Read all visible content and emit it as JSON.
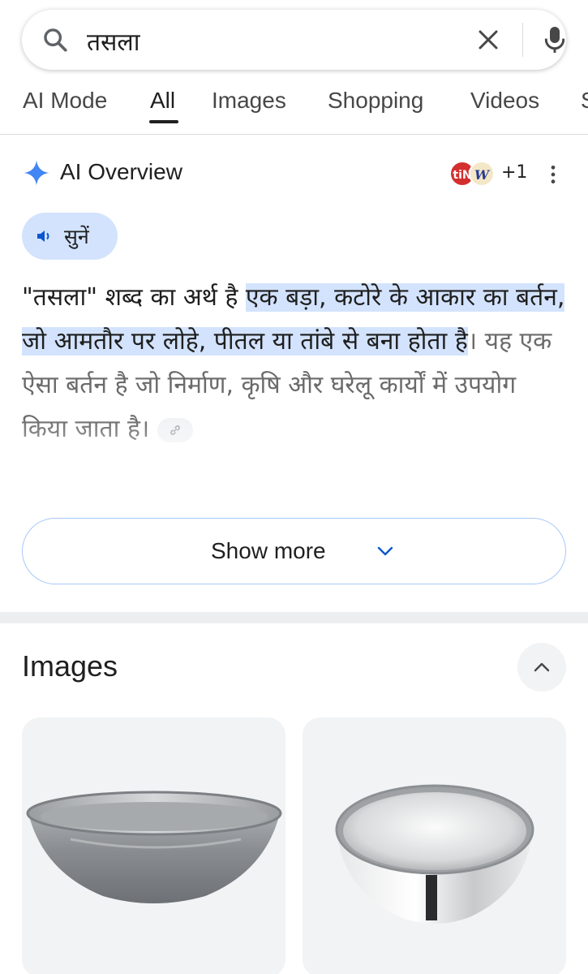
{
  "search": {
    "query": "तसला"
  },
  "tabs": [
    {
      "label": "AI Mode"
    },
    {
      "label": "All"
    },
    {
      "label": "Images"
    },
    {
      "label": "Shopping"
    },
    {
      "label": "Videos"
    },
    {
      "label": "S"
    }
  ],
  "active_tab": "All",
  "ai_overview": {
    "title": "AI Overview",
    "source_count": "+1",
    "source_icons": [
      "tiN",
      "W"
    ],
    "listen_label": "सुनें",
    "answer": {
      "part1": "\"तसला\" शब्द का अर्थ है ",
      "highlight": "एक बड़ा, कटोरे के आकार का बर्तन, जो आमतौर पर लोहे, पीतल या तांबे से बना होता है",
      "part2": "। यह एक ऐसा बर्तन है जो निर्माण, कृषि और घरेलू कार्यों में उपयोग किया जाता है।"
    },
    "show_more_label": "Show more"
  },
  "images_section": {
    "title": "Images",
    "items": [
      {
        "name": "aluminium-tasla-image"
      },
      {
        "name": "steel-bowl-image"
      }
    ]
  },
  "colors": {
    "accent_blue": "#1a73e8",
    "highlight": "#d3e3fd",
    "chip_border": "#a8c7fa"
  }
}
